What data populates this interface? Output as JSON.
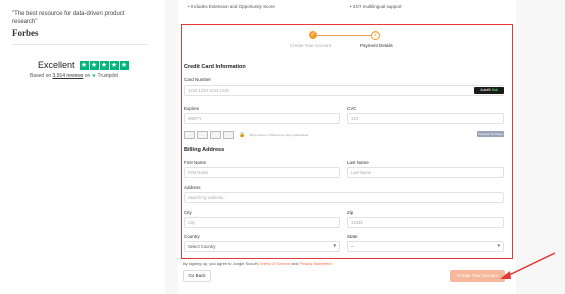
{
  "sidebar": {
    "quote": "\"The best resource for data-driven product research\"",
    "forbes_logo": "Forbes",
    "trustpilot": {
      "rating_word": "Excellent",
      "stars": 5,
      "based_on_prefix": "Based on",
      "reviews": "3,914 reviews",
      "on": "on",
      "brand": "Trustpilot"
    }
  },
  "topbar": {
    "bullet1": "Includes Extension and Opportunity Score",
    "bullet2": "24/7 multilingual support"
  },
  "stepper": {
    "step1_number": "✓",
    "step1_label": "Create Your Account",
    "step2_number": "2",
    "step2_label": "Payment Details"
  },
  "payment": {
    "section_title": "Credit Card Information",
    "card_number_label": "Card Number",
    "card_number_placeholder": "1234 1234 1234 1234",
    "autofill_label": "Autofill",
    "autofill_link": "link",
    "expires_label": "Expires",
    "expires_placeholder": "MM/YY",
    "cvc_label": "CVC",
    "cvc_placeholder": "123",
    "secure_text": "We're secure: 256-bit encryption guaranteed",
    "stripe_badge": "Powered by Stripe"
  },
  "billing": {
    "section_title": "Billing Address",
    "first_name_label": "First Name",
    "first_name_placeholder": "First Name",
    "last_name_label": "Last Name",
    "last_name_placeholder": "Last Name",
    "address_label": "Address",
    "address_placeholder": "Search by address...",
    "city_label": "City",
    "city_placeholder": "City",
    "zip_label": "Zip",
    "zip_placeholder": "12345",
    "country_label": "Country",
    "country_value": "Select Country",
    "state_label": "State",
    "state_value": "--"
  },
  "footer": {
    "consent_prefix": "By signing up, you agree to Jungle Scout's",
    "terms": "Terms Of Service",
    "and": "and",
    "privacy": "Privacy Statement",
    "go_back": "Go Back",
    "create_account": "Create Your Account"
  },
  "colors": {
    "accent": "#f39c32",
    "highlight_border": "#e53935",
    "trustpilot_green": "#00b67a"
  }
}
